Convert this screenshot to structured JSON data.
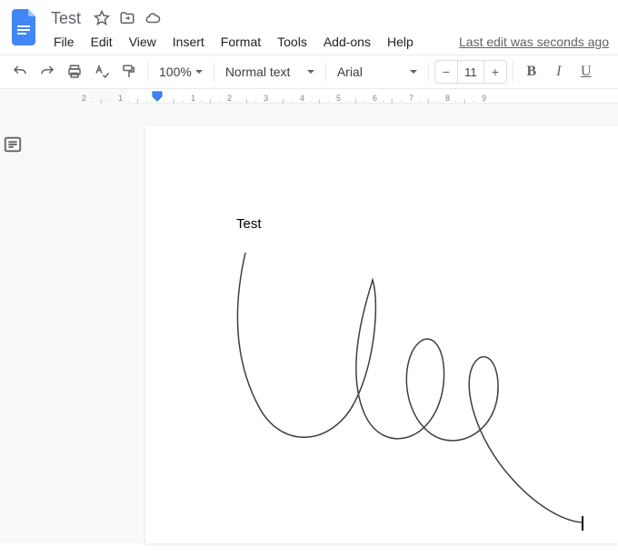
{
  "doc": {
    "title": "Test",
    "content_text": "Test"
  },
  "menubar": {
    "items": [
      "File",
      "Edit",
      "View",
      "Insert",
      "Format",
      "Tools",
      "Add-ons",
      "Help"
    ],
    "last_edit": "Last edit was seconds ago"
  },
  "toolbar": {
    "zoom": "100%",
    "style": "Normal text",
    "font": "Arial",
    "font_size": "11",
    "minus": "−",
    "plus": "+",
    "bold": "B",
    "italic": "I",
    "underline": "U"
  },
  "ruler": {
    "labels": [
      "2",
      "1",
      "1",
      "2",
      "3",
      "4",
      "5",
      "6",
      "7",
      "8",
      "9"
    ]
  },
  "icons": {
    "star": "star-icon",
    "move": "move-to-folder-icon",
    "cloud": "cloud-saved-icon",
    "undo": "undo-icon",
    "redo": "redo-icon",
    "print": "print-icon",
    "spellcheck": "spellcheck-icon",
    "paintformat": "paint-format-icon",
    "outline": "outline-icon"
  }
}
